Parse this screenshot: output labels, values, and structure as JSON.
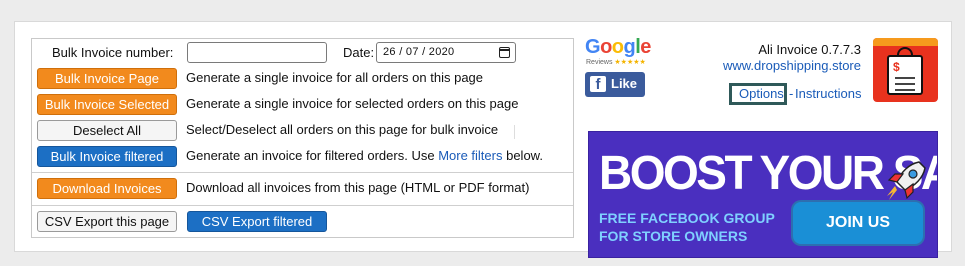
{
  "bulk": {
    "number_label": "Bulk Invoice number:",
    "number_value": "",
    "date_label": "Date:",
    "date_value": "26 / 07 / 2020"
  },
  "rows": [
    {
      "button": "Bulk Invoice Page",
      "description": "Generate a single invoice for all orders on this page"
    },
    {
      "button": "Bulk Invoice Selected",
      "description": "Generate a single invoice for selected orders on this page"
    },
    {
      "button": "Deselect All",
      "description": "Select/Deselect all orders on this page for bulk invoice"
    },
    {
      "button": "Bulk Invoice filtered",
      "description_before": "Generate an invoice for filtered orders. Use ",
      "description_link": "More filters",
      "description_after": " below."
    },
    {
      "button": "Download Invoices",
      "description": "Download all invoices from this page (HTML or PDF format)"
    }
  ],
  "export": {
    "page_button": "CSV Export this page",
    "filtered_button": "CSV Export filtered"
  },
  "google": {
    "logo_text": "Google",
    "reviews_text": "Reviews",
    "stars": "★★★★★"
  },
  "facebook": {
    "glyph": "f",
    "like_label": "Like"
  },
  "app": {
    "name_version": "Ali Invoice 0.7.7.3",
    "site": "www.dropshipping.store",
    "options": "Options",
    "separator": "-",
    "instructions": "Instructions"
  },
  "banner": {
    "headline": "BOOST YOUR SALES",
    "sub_line1": "FREE FACEBOOK GROUP",
    "sub_line2": "FOR STORE OWNERS",
    "cta": "JOIN US"
  },
  "icons": [
    "google-reviews-logo",
    "facebook-icon",
    "shopping-bag-invoice-icon",
    "rocket-icon",
    "calendar-icon"
  ],
  "colors": {
    "orange": "#f28a1d",
    "blue": "#1c6fc4",
    "link": "#1a5bb8",
    "banner": "#4a2fbf",
    "highlight_box": "#2f5959"
  }
}
